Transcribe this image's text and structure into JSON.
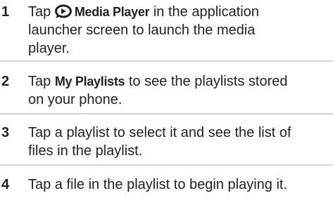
{
  "steps": [
    {
      "number": "1",
      "prefix": "Tap",
      "icon": "media-player-icon",
      "label": "Media Player",
      "line_rest_1": "in the application",
      "line_2": "launcher screen to launch the media",
      "line_3": "player."
    },
    {
      "number": "2",
      "prefix": "Tap",
      "label": "My Playlists",
      "line_rest_1": "to see the playlists stored",
      "line_2": "on your phone."
    },
    {
      "number": "3",
      "line_1": "Tap a playlist to select it and see the list of",
      "line_2": "files in the playlist."
    },
    {
      "number": "4",
      "line_1": "Tap a file in the playlist to begin playing it."
    }
  ]
}
